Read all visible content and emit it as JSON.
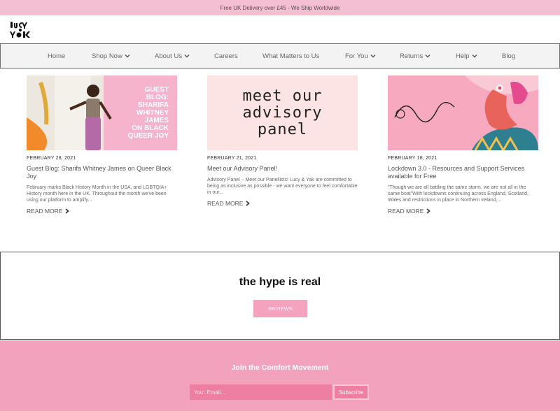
{
  "topbar": {
    "text": "Free UK Delivery over £45 - We Ship Worldwide"
  },
  "logo": {
    "name": "Lucy & Yak logo"
  },
  "nav": {
    "items": [
      {
        "label": "Home",
        "dropdown": false
      },
      {
        "label": "Shop Now",
        "dropdown": true
      },
      {
        "label": "About Us",
        "dropdown": true
      },
      {
        "label": "Careers",
        "dropdown": false
      },
      {
        "label": "What Matters to Us",
        "dropdown": false
      },
      {
        "label": "For You",
        "dropdown": true
      },
      {
        "label": "Returns",
        "dropdown": true
      },
      {
        "label": "Help",
        "dropdown": true
      },
      {
        "label": "Blog",
        "dropdown": false
      }
    ]
  },
  "posts": [
    {
      "image_text": [
        "GUEST",
        "BLOG:",
        "SHARIFA",
        "WHITNEY",
        "JAMES",
        "ON BLACK",
        "QUEER JOY"
      ],
      "date": "FEBRUARY 28, 2021",
      "title": "Guest Blog: Sharifa Whitney James on Queer Black Joy",
      "excerpt": "February marks Black History Month in the USA, and LGBTQIA+ History month here in the UK. Throughout the month we've been using our platform to amplify...",
      "more": "READ MORE"
    },
    {
      "image_text": [
        "meet our",
        "advisory",
        "panel"
      ],
      "date": "FEBRUARY 21, 2021",
      "title": "Meet our Advisory Panel!",
      "excerpt": "Advisory Panel – Meet our Panellists! Lucy & Yak are committed to being as inclusive as possible - we want everyone to feel comfortable in our...",
      "more": "READ MORE"
    },
    {
      "date": "FEBRUARY 18, 2021",
      "title": "Lockdown 3.0 - Resources and Support Services available for Free",
      "excerpt": "\"Though we are all battling the same storm, we are not all in the same boat\"With lockdowns continuing across England, Scotland, Wales and restrictions in place in Northern Ireland,...",
      "more": "READ MORE"
    }
  ],
  "hype": {
    "heading": "the hype is real",
    "button": "REVIEWS"
  },
  "footer": {
    "heading": "Join the Comfort Movement",
    "email_placeholder": "Your Email...",
    "subscribe": "Subscribe"
  },
  "colors": {
    "pink": "#f4bfd3",
    "footer_pink": "#f2a2bc",
    "input_pink": "#ee7fa3"
  }
}
